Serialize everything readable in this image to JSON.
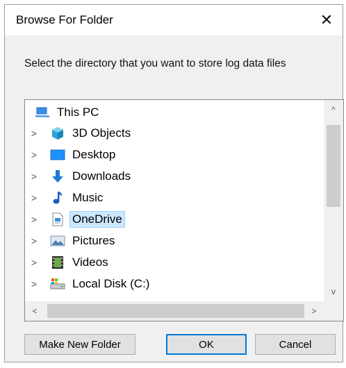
{
  "dialog": {
    "title": "Browse For Folder",
    "close_glyph": "✕",
    "instruction": "Select the directory that you want to store log data files"
  },
  "tree": {
    "items": [
      {
        "label": "This PC",
        "icon": "this-pc-icon",
        "expander": "",
        "selected": false
      },
      {
        "label": "3D Objects",
        "icon": "3d-objects-icon",
        "expander": ">",
        "selected": false
      },
      {
        "label": "Desktop",
        "icon": "desktop-icon",
        "expander": ">",
        "selected": false
      },
      {
        "label": "Downloads",
        "icon": "downloads-icon",
        "expander": ">",
        "selected": false
      },
      {
        "label": "Music",
        "icon": "music-icon",
        "expander": ">",
        "selected": false
      },
      {
        "label": "OneDrive",
        "icon": "onedrive-icon",
        "expander": ">",
        "selected": true
      },
      {
        "label": "Pictures",
        "icon": "pictures-icon",
        "expander": ">",
        "selected": false
      },
      {
        "label": "Videos",
        "icon": "videos-icon",
        "expander": ">",
        "selected": false
      },
      {
        "label": "Local Disk (C:)",
        "icon": "local-disk-icon",
        "expander": ">",
        "selected": false
      }
    ],
    "vscroll_up": "^",
    "vscroll_down": "v",
    "hscroll_left": "<",
    "hscroll_right": ">"
  },
  "buttons": {
    "make_new_folder": "Make New Folder",
    "ok": "OK",
    "cancel": "Cancel"
  },
  "colors": {
    "selection_bg": "#cce8ff",
    "default_button_border": "#0078d7"
  }
}
